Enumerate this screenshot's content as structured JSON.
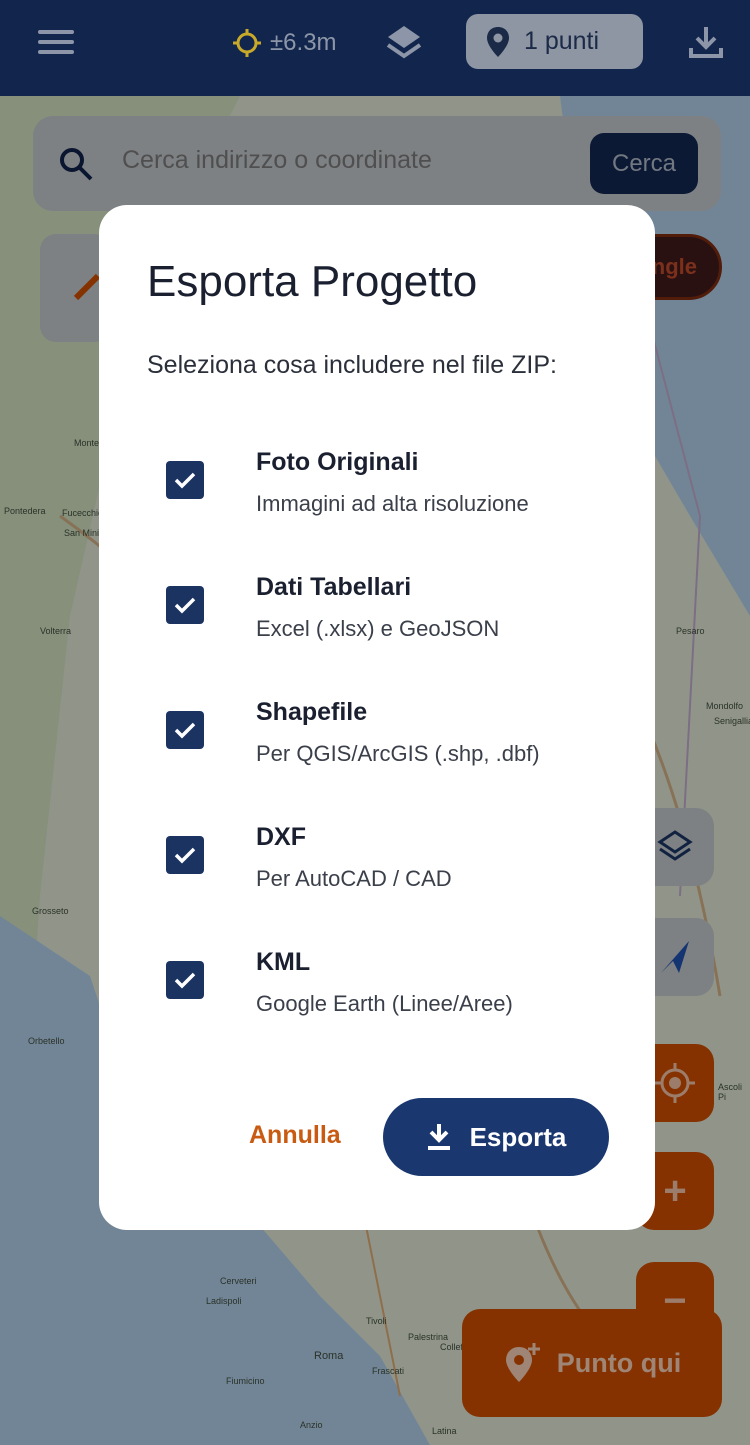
{
  "topbar": {
    "gps_accuracy": "±6.3m",
    "points_label": "1 punti"
  },
  "search": {
    "placeholder": "Cerca indirizzo o coordinate",
    "button_label": "Cerca"
  },
  "angle_pill_label": "ngle",
  "map_labels": [
    "Montecatini",
    "Fucecchio",
    "San Miniato",
    "Pontedera",
    "Volterra",
    "Grosseto",
    "Orbetello",
    "Pesaro",
    "Mondolfo",
    "Senigallia",
    "Ascoli Pi",
    "Roma",
    "Cerveteri",
    "Ladispoli",
    "Fiumicino",
    "Frascati",
    "Tivoli",
    "Anzio",
    "Latina",
    "Colleferro",
    "Palestrina"
  ],
  "dialog": {
    "title": "Esporta Progetto",
    "subtitle": "Seleziona cosa includere nel file ZIP:",
    "options": [
      {
        "title": "Foto Originali",
        "desc": "Immagini ad alta risoluzione",
        "checked": true
      },
      {
        "title": "Dati Tabellari",
        "desc": "Excel (.xlsx) e GeoJSON",
        "checked": true
      },
      {
        "title": "Shapefile",
        "desc": "Per QGIS/ArcGIS (.shp, .dbf)",
        "checked": true
      },
      {
        "title": "DXF",
        "desc": "Per AutoCAD / CAD",
        "checked": true
      },
      {
        "title": "KML",
        "desc": "Google Earth (Linee/Aree)",
        "checked": true
      }
    ],
    "cancel_label": "Annulla",
    "export_label": "Esporta"
  },
  "fab": {
    "plus_label": "+",
    "minus_label": "−",
    "punto_label": "Punto qui"
  },
  "colors": {
    "topbar": "#12264d",
    "primary": "#1a3770",
    "accent_orange": "#c44b00",
    "cancel_text": "#c85a12"
  },
  "icons": [
    "menu-icon",
    "gps-crosshair-icon",
    "layers-icon",
    "location-pin-icon",
    "download-icon",
    "search-icon",
    "pencil-icon",
    "navigation-arrow-icon",
    "my-location-icon",
    "add-location-icon",
    "checkmark-icon"
  ]
}
